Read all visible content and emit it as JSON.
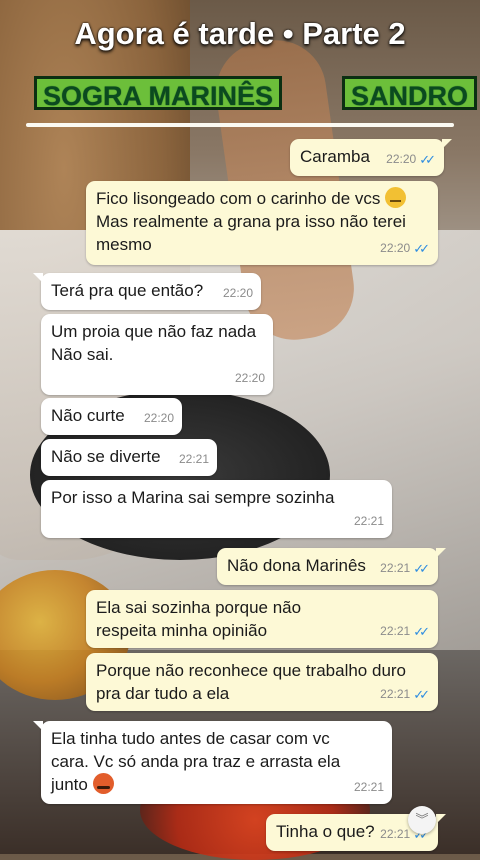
{
  "header": {
    "title": "Agora é tarde • Parte 2",
    "left_name": "SOGRA MARINÊS",
    "right_name": "SANDRO"
  },
  "colors": {
    "incoming": "#ffffff",
    "outgoing": "#fdf9d6",
    "read_check": "#2f8de0",
    "name_tag": "#6cbf3a"
  },
  "messages": [
    {
      "dir": "out",
      "text": "Caramba",
      "time": "22:20",
      "read": true
    },
    {
      "dir": "out",
      "text": "Fico lisongeado com o carinho de vcs",
      "text2": "Mas realmente a grana pra isso não terei mesmo",
      "emoji": "neutral-face",
      "time": "22:20",
      "read": true
    },
    {
      "dir": "in",
      "text": "Terá pra que então?",
      "time": "22:20"
    },
    {
      "dir": "in",
      "text": "Um proia que não faz nada\nNão sai.",
      "time": "22:20"
    },
    {
      "dir": "in",
      "text": "Não curte",
      "time": "22:20"
    },
    {
      "dir": "in",
      "text": "Não se diverte",
      "time": "22:21"
    },
    {
      "dir": "in",
      "text": "Por isso a Marina sai sempre sozinha",
      "time": "22:21"
    },
    {
      "dir": "out",
      "text": "Não dona Marinês",
      "time": "22:21",
      "read": true
    },
    {
      "dir": "out",
      "text": "Ela sai sozinha porque não respeita minha opinião",
      "time": "22:21",
      "read": true
    },
    {
      "dir": "out",
      "text": "Porque não reconhece que trabalho duro pra dar tudo a ela",
      "time": "22:21",
      "read": true
    },
    {
      "dir": "in",
      "text": "Ela tinha tudo antes de casar com vc cara. Vc só anda pra traz e arrasta ela junto",
      "emoji": "angry-face",
      "time": "22:21"
    },
    {
      "dir": "out",
      "text": "Tinha o que?",
      "time": "22:21",
      "read": true
    }
  ],
  "icons": {
    "scroll_down": "chevron-double-down-icon"
  }
}
